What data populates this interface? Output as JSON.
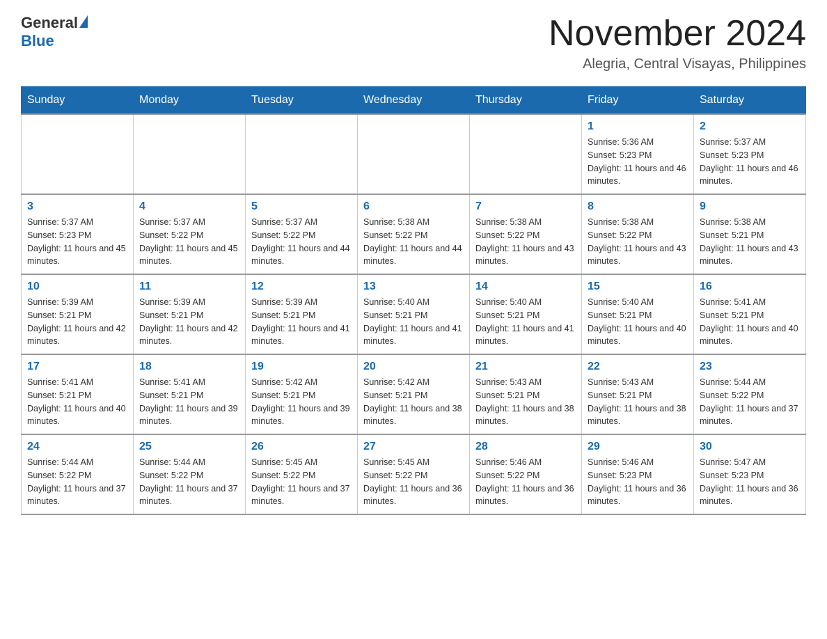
{
  "header": {
    "logo_general": "General",
    "logo_blue": "Blue",
    "month_title": "November 2024",
    "location": "Alegria, Central Visayas, Philippines"
  },
  "days_of_week": [
    "Sunday",
    "Monday",
    "Tuesday",
    "Wednesday",
    "Thursday",
    "Friday",
    "Saturday"
  ],
  "weeks": [
    [
      {
        "day": "",
        "info": ""
      },
      {
        "day": "",
        "info": ""
      },
      {
        "day": "",
        "info": ""
      },
      {
        "day": "",
        "info": ""
      },
      {
        "day": "",
        "info": ""
      },
      {
        "day": "1",
        "info": "Sunrise: 5:36 AM\nSunset: 5:23 PM\nDaylight: 11 hours and 46 minutes."
      },
      {
        "day": "2",
        "info": "Sunrise: 5:37 AM\nSunset: 5:23 PM\nDaylight: 11 hours and 46 minutes."
      }
    ],
    [
      {
        "day": "3",
        "info": "Sunrise: 5:37 AM\nSunset: 5:23 PM\nDaylight: 11 hours and 45 minutes."
      },
      {
        "day": "4",
        "info": "Sunrise: 5:37 AM\nSunset: 5:22 PM\nDaylight: 11 hours and 45 minutes."
      },
      {
        "day": "5",
        "info": "Sunrise: 5:37 AM\nSunset: 5:22 PM\nDaylight: 11 hours and 44 minutes."
      },
      {
        "day": "6",
        "info": "Sunrise: 5:38 AM\nSunset: 5:22 PM\nDaylight: 11 hours and 44 minutes."
      },
      {
        "day": "7",
        "info": "Sunrise: 5:38 AM\nSunset: 5:22 PM\nDaylight: 11 hours and 43 minutes."
      },
      {
        "day": "8",
        "info": "Sunrise: 5:38 AM\nSunset: 5:22 PM\nDaylight: 11 hours and 43 minutes."
      },
      {
        "day": "9",
        "info": "Sunrise: 5:38 AM\nSunset: 5:21 PM\nDaylight: 11 hours and 43 minutes."
      }
    ],
    [
      {
        "day": "10",
        "info": "Sunrise: 5:39 AM\nSunset: 5:21 PM\nDaylight: 11 hours and 42 minutes."
      },
      {
        "day": "11",
        "info": "Sunrise: 5:39 AM\nSunset: 5:21 PM\nDaylight: 11 hours and 42 minutes."
      },
      {
        "day": "12",
        "info": "Sunrise: 5:39 AM\nSunset: 5:21 PM\nDaylight: 11 hours and 41 minutes."
      },
      {
        "day": "13",
        "info": "Sunrise: 5:40 AM\nSunset: 5:21 PM\nDaylight: 11 hours and 41 minutes."
      },
      {
        "day": "14",
        "info": "Sunrise: 5:40 AM\nSunset: 5:21 PM\nDaylight: 11 hours and 41 minutes."
      },
      {
        "day": "15",
        "info": "Sunrise: 5:40 AM\nSunset: 5:21 PM\nDaylight: 11 hours and 40 minutes."
      },
      {
        "day": "16",
        "info": "Sunrise: 5:41 AM\nSunset: 5:21 PM\nDaylight: 11 hours and 40 minutes."
      }
    ],
    [
      {
        "day": "17",
        "info": "Sunrise: 5:41 AM\nSunset: 5:21 PM\nDaylight: 11 hours and 40 minutes."
      },
      {
        "day": "18",
        "info": "Sunrise: 5:41 AM\nSunset: 5:21 PM\nDaylight: 11 hours and 39 minutes."
      },
      {
        "day": "19",
        "info": "Sunrise: 5:42 AM\nSunset: 5:21 PM\nDaylight: 11 hours and 39 minutes."
      },
      {
        "day": "20",
        "info": "Sunrise: 5:42 AM\nSunset: 5:21 PM\nDaylight: 11 hours and 38 minutes."
      },
      {
        "day": "21",
        "info": "Sunrise: 5:43 AM\nSunset: 5:21 PM\nDaylight: 11 hours and 38 minutes."
      },
      {
        "day": "22",
        "info": "Sunrise: 5:43 AM\nSunset: 5:21 PM\nDaylight: 11 hours and 38 minutes."
      },
      {
        "day": "23",
        "info": "Sunrise: 5:44 AM\nSunset: 5:22 PM\nDaylight: 11 hours and 37 minutes."
      }
    ],
    [
      {
        "day": "24",
        "info": "Sunrise: 5:44 AM\nSunset: 5:22 PM\nDaylight: 11 hours and 37 minutes."
      },
      {
        "day": "25",
        "info": "Sunrise: 5:44 AM\nSunset: 5:22 PM\nDaylight: 11 hours and 37 minutes."
      },
      {
        "day": "26",
        "info": "Sunrise: 5:45 AM\nSunset: 5:22 PM\nDaylight: 11 hours and 37 minutes."
      },
      {
        "day": "27",
        "info": "Sunrise: 5:45 AM\nSunset: 5:22 PM\nDaylight: 11 hours and 36 minutes."
      },
      {
        "day": "28",
        "info": "Sunrise: 5:46 AM\nSunset: 5:22 PM\nDaylight: 11 hours and 36 minutes."
      },
      {
        "day": "29",
        "info": "Sunrise: 5:46 AM\nSunset: 5:23 PM\nDaylight: 11 hours and 36 minutes."
      },
      {
        "day": "30",
        "info": "Sunrise: 5:47 AM\nSunset: 5:23 PM\nDaylight: 11 hours and 36 minutes."
      }
    ]
  ]
}
